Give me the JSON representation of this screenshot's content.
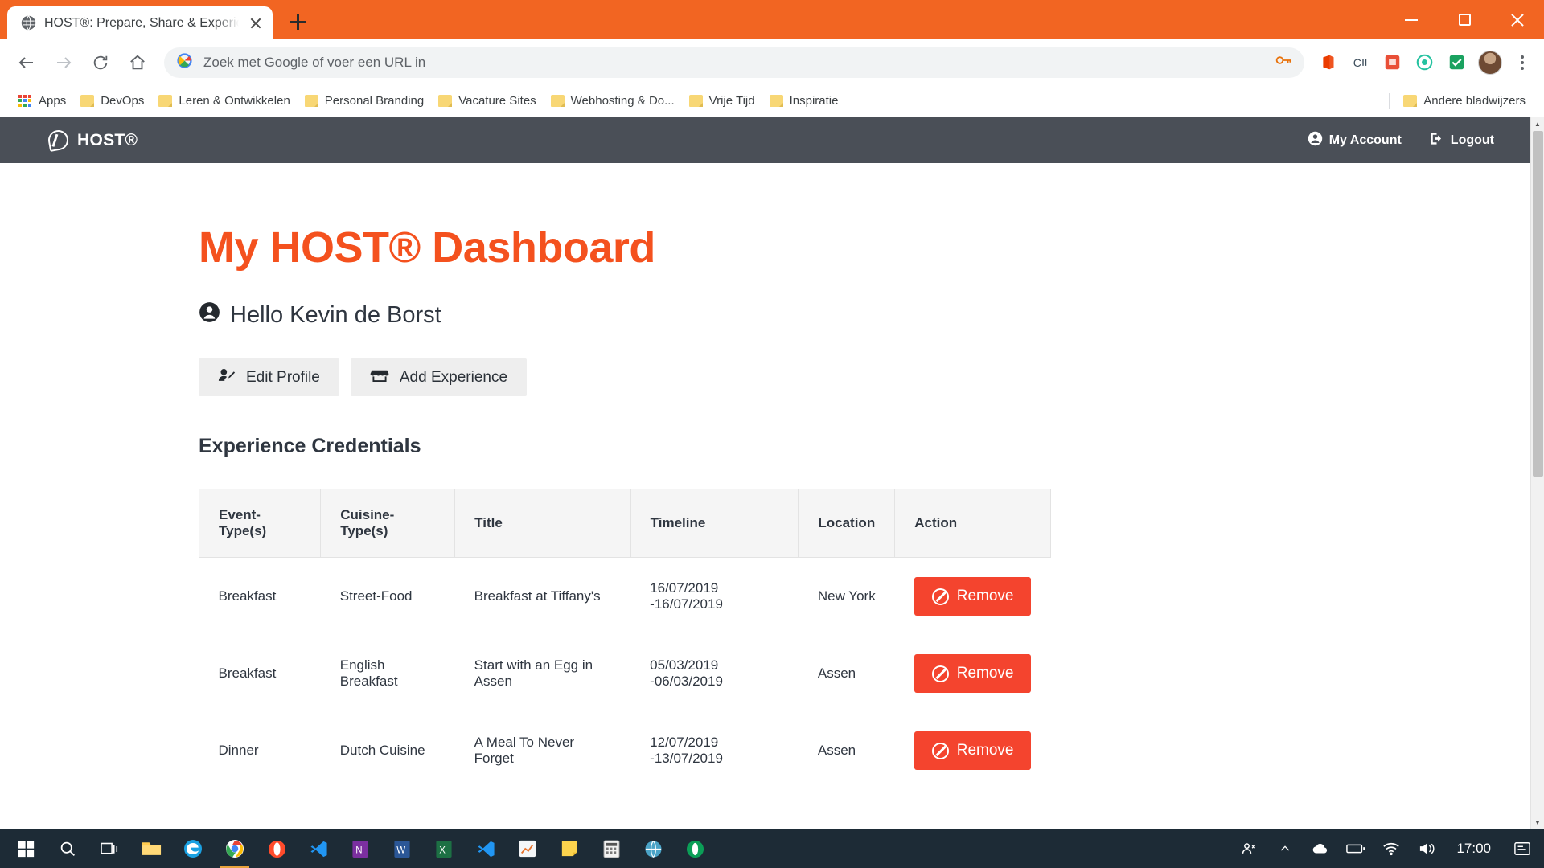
{
  "browser": {
    "tab": {
      "title": "HOST®: Prepare, Share & Experie",
      "favicon": "globe-icon",
      "close": "close-icon"
    },
    "new_tab_label": "+",
    "window_controls": {
      "minimize": "minimize-icon",
      "maximize": "maximize-icon",
      "close": "close-icon"
    },
    "toolbar": {
      "back": "back-arrow-icon",
      "forward": "forward-arrow-icon",
      "reload": "reload-icon",
      "home": "home-icon",
      "omnibox_placeholder": "Zoek met Google of voer een URL in",
      "omnibox_value": "",
      "search_icon": "google-g-icon",
      "password_icon": "key-icon",
      "extensions": [
        "office-icon",
        "c-sharp-icon",
        "puzzle-icon",
        "circle-icon",
        "checkmark-icon"
      ],
      "profile": "avatar",
      "menu": "kebab-menu-icon"
    },
    "bookmarks": {
      "apps_label": "Apps",
      "items": [
        {
          "label": "DevOps"
        },
        {
          "label": "Leren & Ontwikkelen"
        },
        {
          "label": "Personal Branding"
        },
        {
          "label": "Vacature Sites"
        },
        {
          "label": "Webhosting & Do..."
        },
        {
          "label": "Vrije Tijd"
        },
        {
          "label": "Inspiratie"
        }
      ],
      "other_label": "Andere bladwijzers"
    }
  },
  "site": {
    "brand": "HOST®",
    "nav_links": [
      {
        "label": "My Account",
        "icon": "user-circle-icon"
      },
      {
        "label": "Logout",
        "icon": "sign-out-icon"
      }
    ],
    "page_title": "My HOST® Dashboard",
    "greeting": "Hello Kevin de Borst",
    "greeting_icon": "user-circle-icon",
    "buttons": [
      {
        "label": "Edit Profile",
        "icon": "user-edit-icon"
      },
      {
        "label": "Add Experience",
        "icon": "store-icon"
      }
    ],
    "section_title": "Experience Credentials",
    "table": {
      "columns": [
        "Event-Type(s)",
        "Cuisine-Type(s)",
        "Title",
        "Timeline",
        "Location",
        "Action"
      ],
      "rows": [
        {
          "event_type": "Breakfast",
          "cuisine_type": "Street-Food",
          "title": "Breakfast at Tiffany's",
          "timeline": "16/07/2019 -16/07/2019",
          "location": "New York",
          "action": "Remove"
        },
        {
          "event_type": "Breakfast",
          "cuisine_type": "English Breakfast",
          "title": "Start with an Egg in Assen",
          "timeline": "05/03/2019 -06/03/2019",
          "location": "Assen",
          "action": "Remove"
        },
        {
          "event_type": "Dinner",
          "cuisine_type": "Dutch Cuisine",
          "title": "A Meal To Never Forget",
          "timeline": "12/07/2019 -13/07/2019",
          "location": "Assen",
          "action": "Remove"
        }
      ]
    },
    "colors": {
      "brand_orange": "#f4511e",
      "nav_dark": "#4a4f57",
      "remove_red": "#f4442e"
    }
  },
  "taskbar": {
    "start": "windows-start-icon",
    "search": "search-icon",
    "task_view": "task-view-icon",
    "apps": [
      "file-explorer-icon",
      "edge-icon",
      "chrome-icon",
      "opera-icon",
      "vscode-icon",
      "onenote-icon",
      "word-icon",
      "excel-icon",
      "vscode-insiders-icon",
      "chart-app-icon",
      "sticky-notes-icon",
      "calculator-icon",
      "globe-app-icon",
      "opera-gx-icon"
    ],
    "tray": [
      "people-icon",
      "chevron-up-icon",
      "cloud-icon",
      "battery-icon",
      "wifi-icon",
      "volume-icon"
    ],
    "clock": "17:00",
    "action_center": "notification-icon"
  }
}
